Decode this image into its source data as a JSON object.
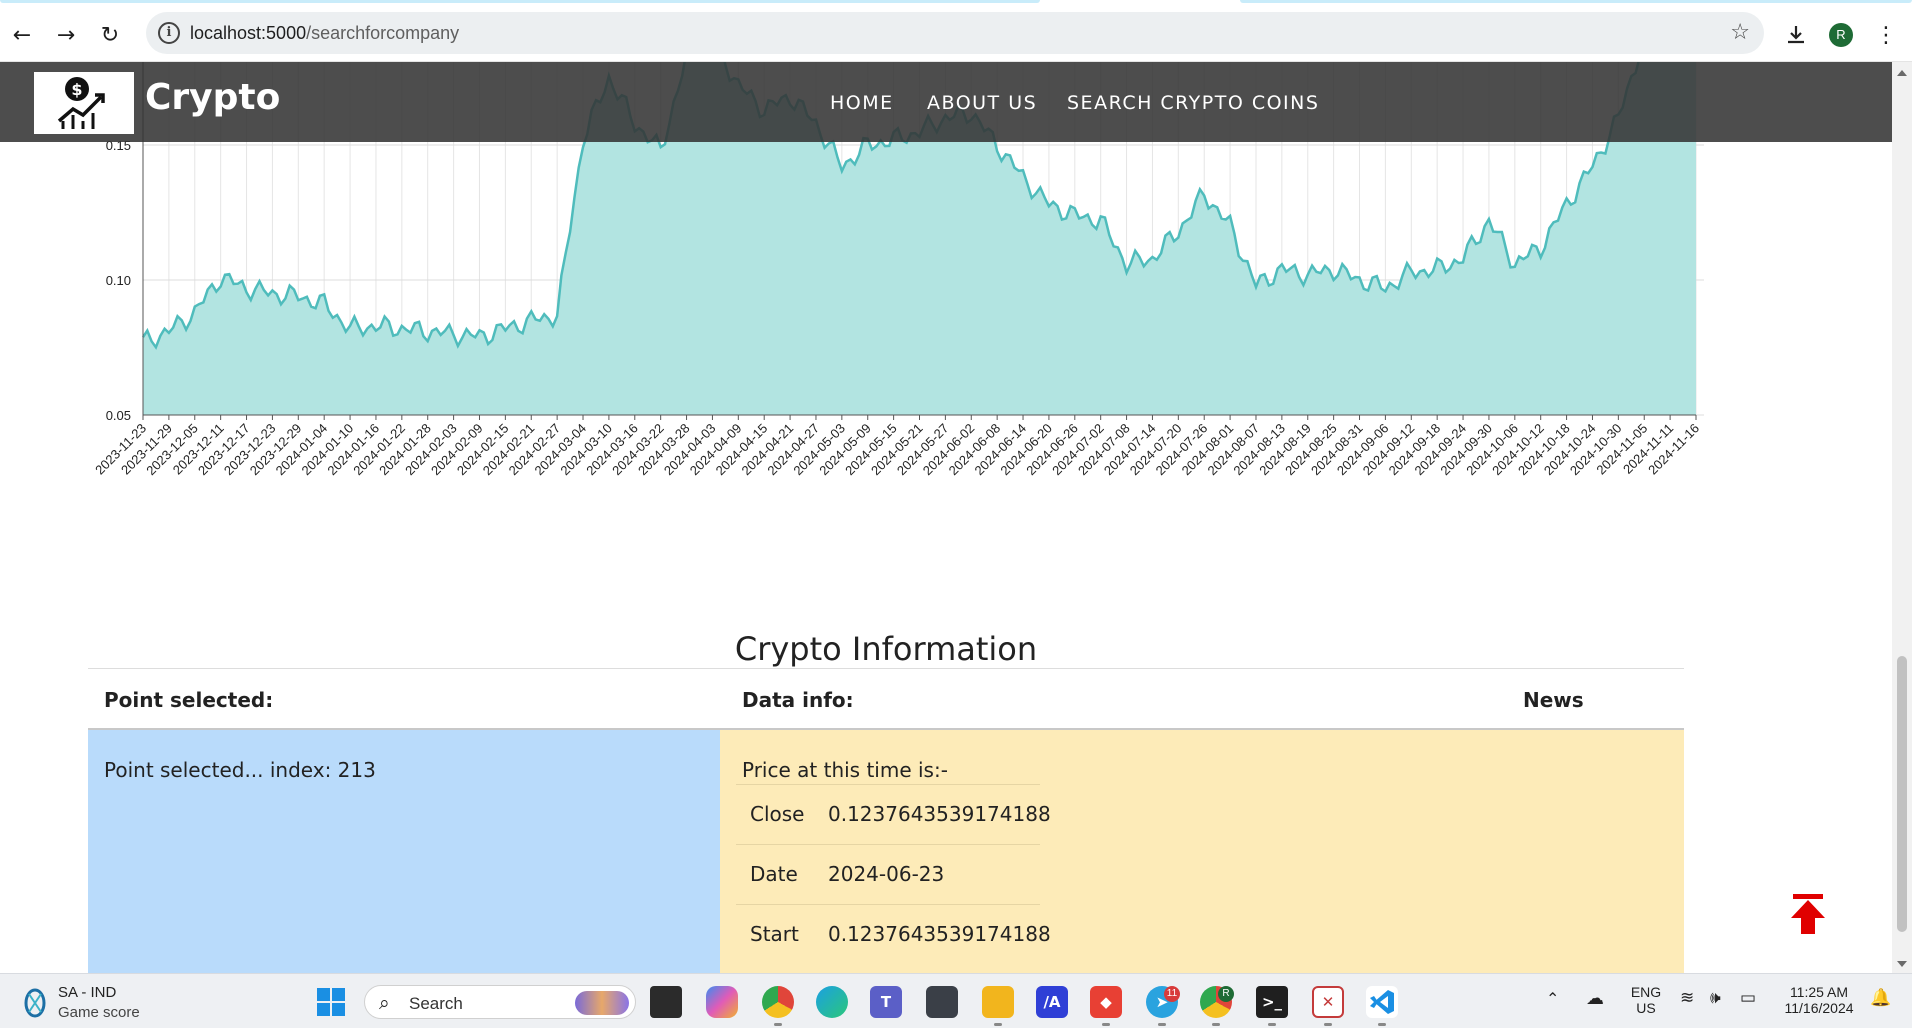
{
  "browser": {
    "url_host": "localhost:5000",
    "url_path": "/searchforcompany",
    "profile_initial": "R"
  },
  "site": {
    "brand": "Crypto",
    "nav": [
      "HOME",
      "ABOUT US",
      "SEARCH CRYPTO COINS"
    ]
  },
  "chart_data": {
    "type": "area",
    "x": [
      "2023-11-23",
      "2023-11-29",
      "2023-12-05",
      "2023-12-11",
      "2023-12-17",
      "2023-12-23",
      "2023-12-29",
      "2024-01-04",
      "2024-01-10",
      "2024-01-16",
      "2024-01-22",
      "2024-01-28",
      "2024-02-03",
      "2024-02-09",
      "2024-02-15",
      "2024-02-21",
      "2024-02-27",
      "2024-03-04",
      "2024-03-10",
      "2024-03-16",
      "2024-03-22",
      "2024-03-28",
      "2024-04-03",
      "2024-04-09",
      "2024-04-15",
      "2024-04-21",
      "2024-04-27",
      "2024-05-03",
      "2024-05-09",
      "2024-05-15",
      "2024-05-21",
      "2024-05-27",
      "2024-06-02",
      "2024-06-08",
      "2024-06-14",
      "2024-06-20",
      "2024-06-26",
      "2024-07-02",
      "2024-07-08",
      "2024-07-14",
      "2024-07-20",
      "2024-07-26",
      "2024-08-01",
      "2024-08-07",
      "2024-08-13",
      "2024-08-19",
      "2024-08-25",
      "2024-08-31",
      "2024-09-06",
      "2024-09-12",
      "2024-09-18",
      "2024-09-24",
      "2024-09-30",
      "2024-10-06",
      "2024-10-12",
      "2024-10-18",
      "2024-10-24",
      "2024-10-30",
      "2024-11-05",
      "2024-11-11",
      "2024-11-16"
    ],
    "values": [
      0.077,
      0.081,
      0.088,
      0.101,
      0.097,
      0.095,
      0.094,
      0.091,
      0.082,
      0.083,
      0.082,
      0.081,
      0.08,
      0.079,
      0.082,
      0.085,
      0.087,
      0.152,
      0.175,
      0.158,
      0.148,
      0.182,
      0.19,
      0.172,
      0.163,
      0.168,
      0.158,
      0.142,
      0.15,
      0.152,
      0.155,
      0.16,
      0.162,
      0.15,
      0.138,
      0.128,
      0.124,
      0.122,
      0.106,
      0.108,
      0.118,
      0.132,
      0.12,
      0.098,
      0.104,
      0.102,
      0.104,
      0.1,
      0.097,
      0.103,
      0.104,
      0.108,
      0.122,
      0.106,
      0.112,
      0.128,
      0.142,
      0.16,
      0.19,
      0.21,
      0.215
    ],
    "yticks": [
      0.05,
      0.1,
      0.15
    ],
    "ylim": [
      0.05,
      0.15
    ],
    "fill_color": "#b2e4e1",
    "line_color": "#4fbcbc",
    "grid": true
  },
  "info": {
    "title": "Crypto Information",
    "headers": {
      "point": "Point selected:",
      "data": "Data info:",
      "news": "News"
    },
    "point_text": "Point selected... index: 213",
    "price_heading": "Price at this time is:-",
    "rows": [
      {
        "key": "Close",
        "value": "0.1237643539174188"
      },
      {
        "key": "Date",
        "value": "2024-06-23"
      },
      {
        "key": "Start",
        "value": "0.1237643539174188"
      }
    ]
  },
  "taskbar": {
    "weather_line1": "SA - IND",
    "weather_line2": "Game score",
    "search_label": "Search",
    "lang_line1": "ENG",
    "lang_line2": "US",
    "time": "11:25 AM",
    "date": "11/16/2024",
    "telegram_badge": "11",
    "chrome_profile_badge": "R"
  }
}
